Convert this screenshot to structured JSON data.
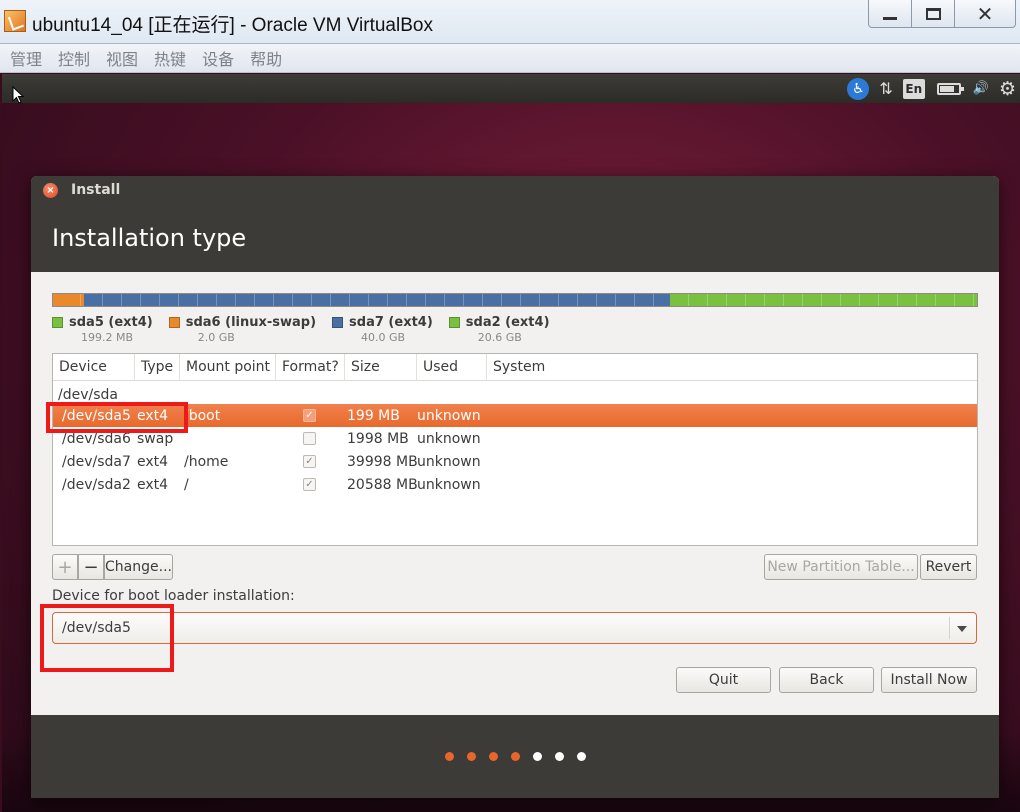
{
  "vbox": {
    "title": "ubuntu14_04 [正在运行] - Oracle VM VirtualBox",
    "menu": [
      "管理",
      "控制",
      "视图",
      "热键",
      "设备",
      "帮助"
    ]
  },
  "panel": {
    "accessibility": "♿",
    "network": "⇅",
    "keyboard_layout": "En",
    "battery_level": 0.8,
    "volume": "🔊",
    "settings": "⚙"
  },
  "installer": {
    "window_title": "Install",
    "heading": "Installation type",
    "disk_bar": [
      {
        "name": "sda5",
        "color": "#e8892c",
        "fraction": 0.0097
      },
      {
        "name": "sda6",
        "color": "#e8892c",
        "fraction": 0.0243
      },
      {
        "name": "sda7",
        "color": "#4a6fa3",
        "fraction": 0.6339
      },
      {
        "name": "sda2",
        "color": "#7ac142",
        "fraction": 0.3321
      }
    ],
    "legend": [
      {
        "label": "sda5 (ext4)",
        "size": "199.2 MB",
        "color": "#7ac142"
      },
      {
        "label": "sda6 (linux-swap)",
        "size": "2.0 GB",
        "color": "#e8892c"
      },
      {
        "label": "sda7 (ext4)",
        "size": "40.0 GB",
        "color": "#4a6fa3"
      },
      {
        "label": "sda2 (ext4)",
        "size": "20.6 GB",
        "color": "#7ac142"
      }
    ],
    "columns": [
      "Device",
      "Type",
      "Mount point",
      "Format?",
      "Size",
      "Used",
      "System"
    ],
    "disk_row": "/dev/sda",
    "rows": [
      {
        "device": "/dev/sda5",
        "type": "ext4",
        "mount": "/boot",
        "format": true,
        "size": "199 MB",
        "used": "unknown",
        "system": "",
        "selected": true
      },
      {
        "device": "/dev/sda6",
        "type": "swap",
        "mount": "",
        "format": false,
        "size": "1998 MB",
        "used": "unknown",
        "system": "",
        "selected": false
      },
      {
        "device": "/dev/sda7",
        "type": "ext4",
        "mount": "/home",
        "format": true,
        "size": "39998 MB",
        "used": "unknown",
        "system": "",
        "selected": false
      },
      {
        "device": "/dev/sda2",
        "type": "ext4",
        "mount": "/",
        "format": true,
        "size": "20588 MB",
        "used": "unknown",
        "system": "",
        "selected": false
      }
    ],
    "buttons": {
      "add": "+",
      "remove": "−",
      "change": "Change...",
      "new_table": "New Partition Table...",
      "revert": "Revert",
      "quit": "Quit",
      "back": "Back",
      "install": "Install Now"
    },
    "boot_loader_label": "Device for boot loader installation:",
    "boot_loader_value": "/dev/sda5",
    "progress_dots": [
      "#e8652c",
      "#e8652c",
      "#e8652c",
      "#e8652c",
      "#ffffff",
      "#ffffff",
      "#ffffff"
    ]
  }
}
